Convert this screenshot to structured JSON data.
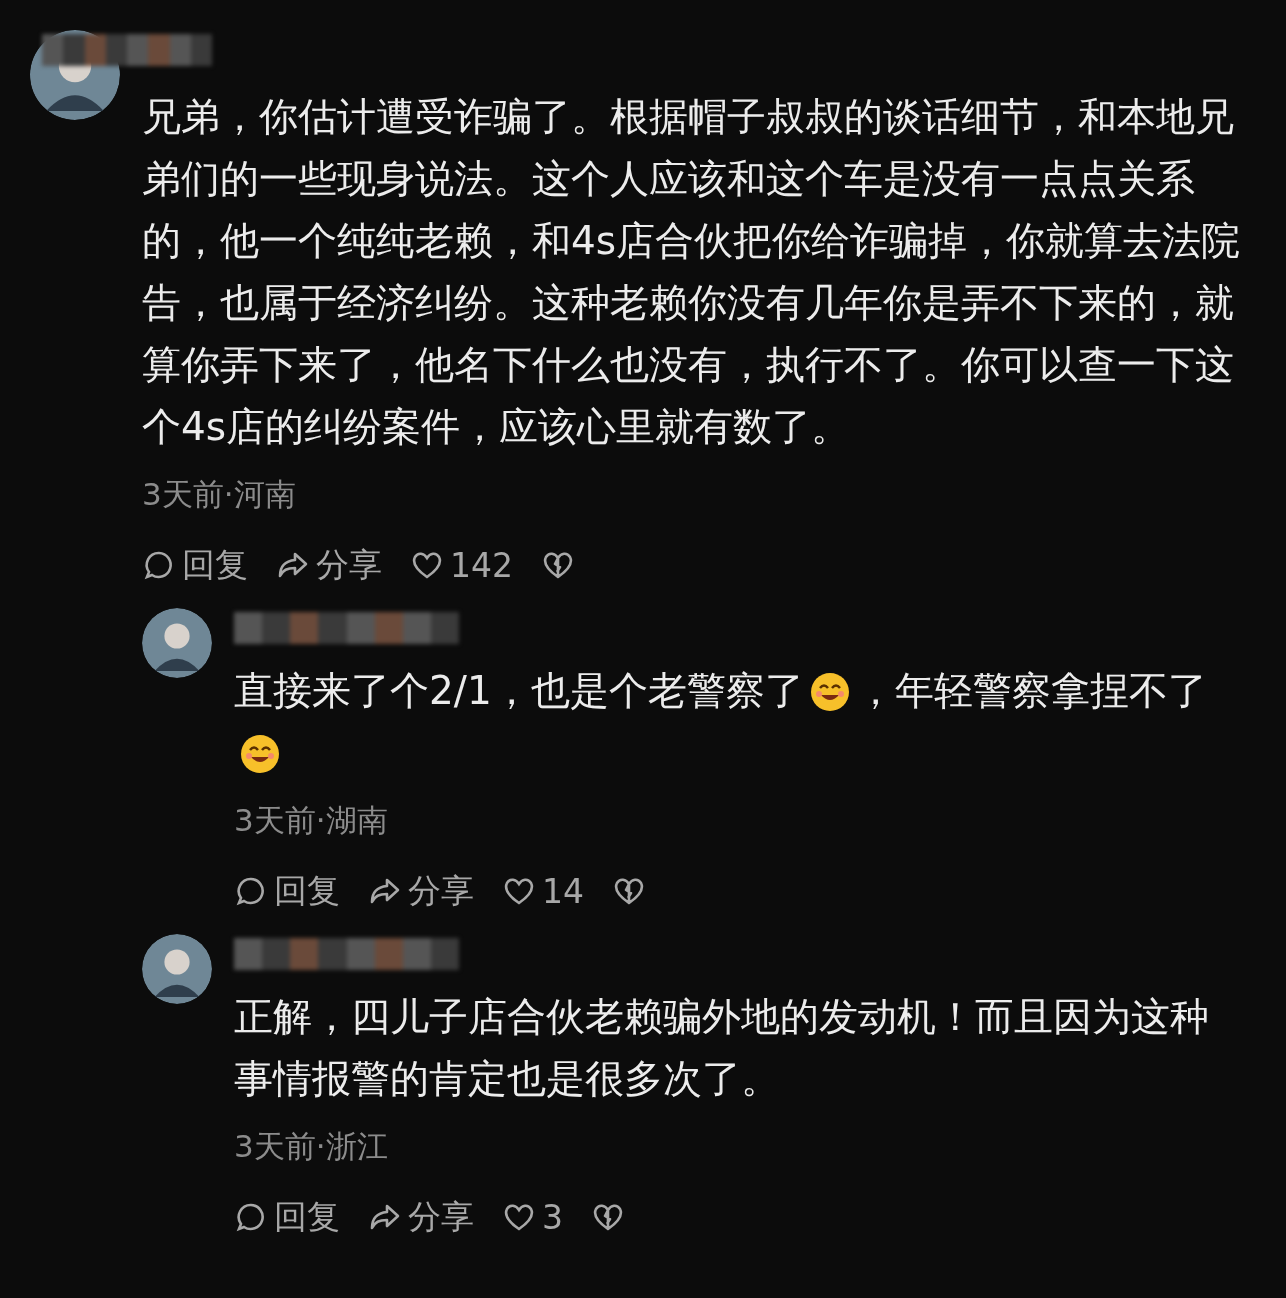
{
  "comments": [
    {
      "segments": [
        {
          "kind": "text",
          "text": "兄弟，你估计遭受诈骗了。根据帽子叔叔的谈话细节，和本地兄弟们的一些现身说法。这个人应该和这个车是没有一点点关系的，他一个纯纯老赖，和4s店合伙把你给诈骗掉，你就算去法院告，也属于经济纠纷。这种老赖你没有几年你是弄不下来的，就算你弄下来了，他名下什么也没有，执行不了。你可以查一下这个4s店的纠纷案件，应该心里就有数了。"
        }
      ],
      "meta": "3天前·河南",
      "reply": "回复",
      "share": "分享",
      "likes": "142",
      "replies": [
        {
          "segments": [
            {
              "kind": "text",
              "text": "直接来了个2/1，也是个老警察了"
            },
            {
              "kind": "emoji"
            },
            {
              "kind": "text",
              "text": "，年轻警察拿捏不了"
            },
            {
              "kind": "emoji"
            }
          ],
          "meta": "3天前·湖南",
          "reply": "回复",
          "share": "分享",
          "likes": "14"
        },
        {
          "segments": [
            {
              "kind": "text",
              "text": "正解，四儿子店合伙老赖骗外地的发动机！而且因为这种事情报警的肯定也是很多次了。"
            }
          ],
          "meta": "3天前·浙江",
          "reply": "回复",
          "share": "分享",
          "likes": "3"
        }
      ]
    }
  ]
}
